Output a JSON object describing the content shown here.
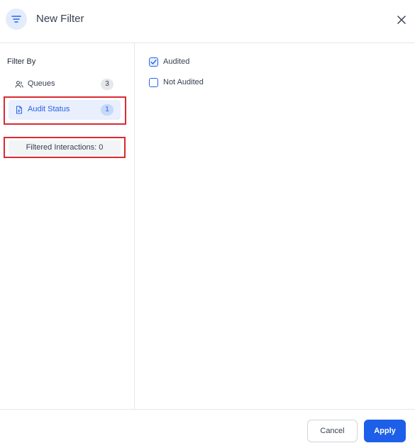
{
  "header": {
    "title": "New Filter",
    "icon": "filter-icon",
    "close_icon": "close-icon"
  },
  "sidebar": {
    "heading": "Filter By",
    "items": [
      {
        "label": "Queues",
        "count": "3",
        "icon": "user-group-icon",
        "selected": false
      },
      {
        "label": "Audit Status",
        "count": "1",
        "icon": "document-icon",
        "selected": true
      }
    ],
    "filtered_interactions": "Filtered Interactions: 0"
  },
  "main": {
    "options": [
      {
        "label": "Audited",
        "checked": true
      },
      {
        "label": "Not Audited",
        "checked": false
      }
    ]
  },
  "footer": {
    "cancel_label": "Cancel",
    "apply_label": "Apply"
  },
  "colors": {
    "accent": "#1d5fe8",
    "highlight": "#d92a32",
    "selected_bg": "#e9effc"
  }
}
